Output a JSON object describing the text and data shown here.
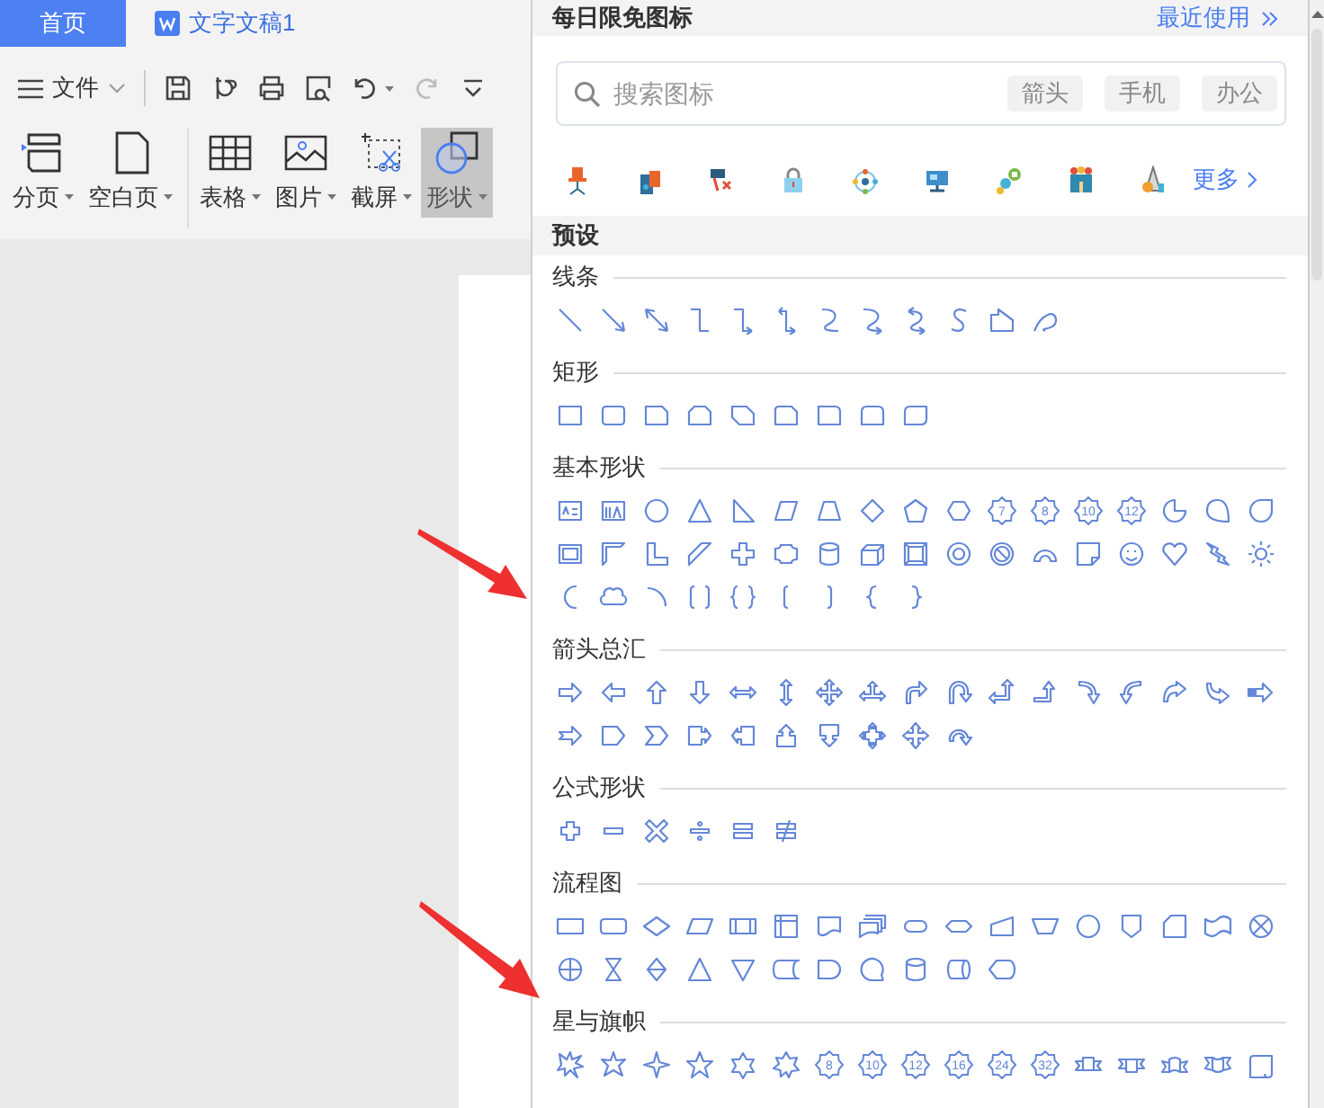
{
  "tabs": [
    {
      "label": "首页",
      "kind": "home",
      "selected": true
    },
    {
      "label": "文字文稿1",
      "kind": "document",
      "selected": false
    }
  ],
  "menu": {
    "label": "文件"
  },
  "quick_tools": [
    {
      "kind": "save",
      "disabled": false
    },
    {
      "kind": "curl",
      "disabled": false
    },
    {
      "kind": "print",
      "disabled": false
    },
    {
      "kind": "preview",
      "disabled": false
    },
    {
      "kind": "undo",
      "disabled": false
    },
    {
      "kind": "redo",
      "disabled": true
    },
    {
      "kind": "more",
      "disabled": false
    }
  ],
  "ribbon_groups": [
    [
      {
        "label": "分页",
        "kind": "page-break",
        "selected": false
      },
      {
        "label": "空白页",
        "kind": "blank-page",
        "selected": false
      }
    ],
    [
      {
        "label": "表格",
        "kind": "table",
        "selected": false
      },
      {
        "label": "图片",
        "kind": "picture",
        "selected": false
      },
      {
        "label": "截屏",
        "kind": "screenshot",
        "selected": false
      },
      {
        "label": "形状",
        "kind": "shape",
        "selected": true
      }
    ]
  ],
  "panel": {
    "title": "每日限免图标",
    "recent": "最近使用",
    "search": {
      "placeholder": "搜索图标",
      "tags": [
        "箭头",
        "手机",
        "办公"
      ]
    },
    "more": "更多",
    "preset_title": "预设",
    "sections": [
      {
        "title": "线条",
        "kind": "lines"
      },
      {
        "title": "矩形",
        "kind": "rectangles"
      },
      {
        "title": "基本形状",
        "kind": "basic",
        "shape_labels": [
          "7",
          "8",
          "10",
          "12"
        ]
      },
      {
        "title": "箭头总汇",
        "kind": "arrows"
      },
      {
        "title": "公式形状",
        "kind": "equation"
      },
      {
        "title": "流程图",
        "kind": "flowchart"
      },
      {
        "title": "星与旗帜",
        "kind": "stars",
        "shape_labels": [
          "8",
          "10",
          "12",
          "16",
          "24",
          "32"
        ]
      }
    ]
  }
}
